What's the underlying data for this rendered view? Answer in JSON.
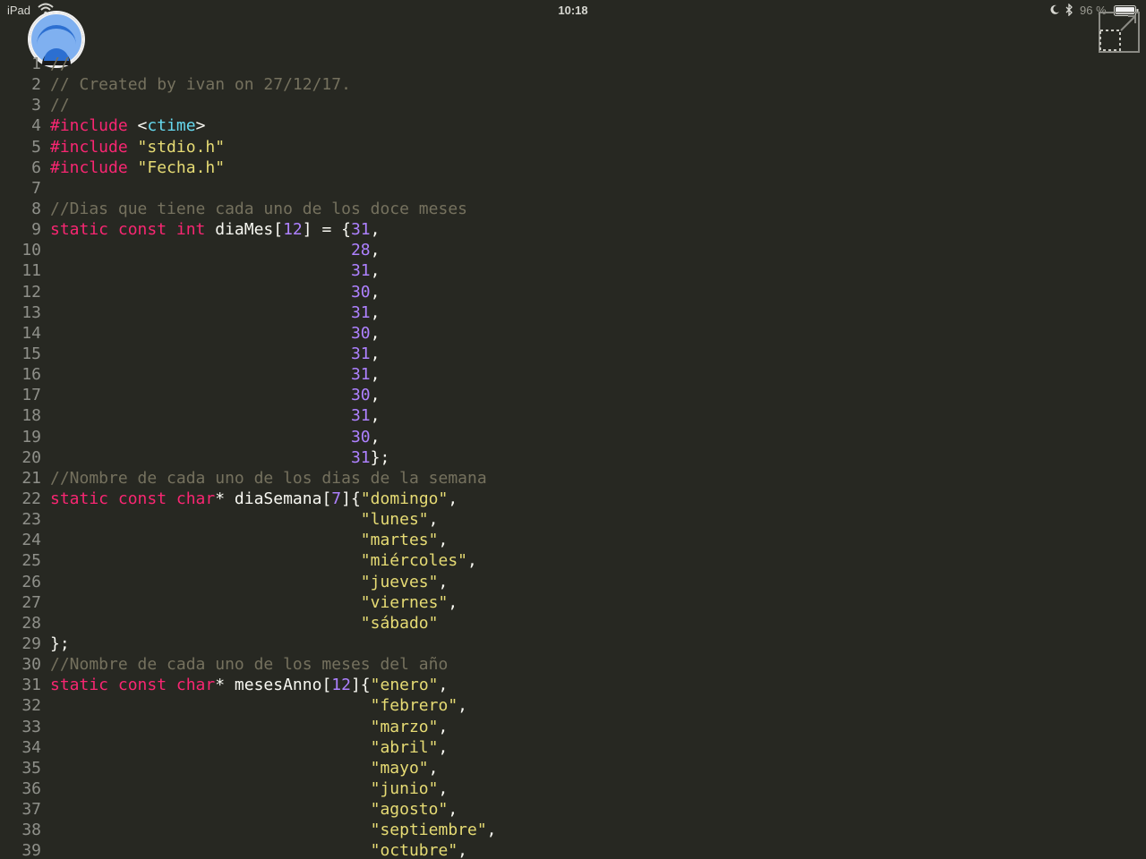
{
  "status_bar": {
    "device": "iPad",
    "time": "10:18",
    "battery": "96 %"
  },
  "colors": {
    "background": "#272822",
    "comment": "#75715e",
    "keyword": "#f92672",
    "string": "#e6db74",
    "number": "#ae81ff",
    "header": "#66d9ef",
    "plain": "#f8f8f2",
    "line_number": "#8f908a"
  },
  "icons": [
    "wifi-icon",
    "moon-icon",
    "bluetooth-icon",
    "battery-icon",
    "app-menu-icon",
    "expand-icon"
  ],
  "editor": {
    "lines": [
      {
        "n": "1",
        "tokens": [
          {
            "t": "comment",
            "v": "//"
          }
        ]
      },
      {
        "n": "2",
        "tokens": [
          {
            "t": "comment",
            "v": "// Created by ivan on 27/12/17."
          }
        ]
      },
      {
        "n": "3",
        "tokens": [
          {
            "t": "comment",
            "v": "//"
          }
        ]
      },
      {
        "n": "4",
        "tokens": [
          {
            "t": "keyword",
            "v": "#include"
          },
          {
            "t": "plain",
            "v": " <"
          },
          {
            "t": "header",
            "v": "ctime"
          },
          {
            "t": "plain",
            "v": ">"
          }
        ]
      },
      {
        "n": "5",
        "tokens": [
          {
            "t": "keyword",
            "v": "#include"
          },
          {
            "t": "plain",
            "v": " "
          },
          {
            "t": "string",
            "v": "\"stdio.h\""
          }
        ]
      },
      {
        "n": "6",
        "tokens": [
          {
            "t": "keyword",
            "v": "#include"
          },
          {
            "t": "plain",
            "v": " "
          },
          {
            "t": "string",
            "v": "\"Fecha.h\""
          }
        ]
      },
      {
        "n": "7",
        "tokens": []
      },
      {
        "n": "8",
        "tokens": [
          {
            "t": "comment",
            "v": "//Dias que tiene cada uno de los doce meses"
          }
        ]
      },
      {
        "n": "9",
        "tokens": [
          {
            "t": "keyword",
            "v": "static const int"
          },
          {
            "t": "plain",
            "v": " diaMes["
          },
          {
            "t": "number",
            "v": "12"
          },
          {
            "t": "plain",
            "v": "] = {"
          },
          {
            "t": "number",
            "v": "31"
          },
          {
            "t": "plain",
            "v": ","
          }
        ]
      },
      {
        "n": "10",
        "tokens": [
          {
            "t": "plain",
            "v": "                               "
          },
          {
            "t": "number",
            "v": "28"
          },
          {
            "t": "plain",
            "v": ","
          }
        ]
      },
      {
        "n": "11",
        "tokens": [
          {
            "t": "plain",
            "v": "                               "
          },
          {
            "t": "number",
            "v": "31"
          },
          {
            "t": "plain",
            "v": ","
          }
        ]
      },
      {
        "n": "12",
        "tokens": [
          {
            "t": "plain",
            "v": "                               "
          },
          {
            "t": "number",
            "v": "30"
          },
          {
            "t": "plain",
            "v": ","
          }
        ]
      },
      {
        "n": "13",
        "tokens": [
          {
            "t": "plain",
            "v": "                               "
          },
          {
            "t": "number",
            "v": "31"
          },
          {
            "t": "plain",
            "v": ","
          }
        ]
      },
      {
        "n": "14",
        "tokens": [
          {
            "t": "plain",
            "v": "                               "
          },
          {
            "t": "number",
            "v": "30"
          },
          {
            "t": "plain",
            "v": ","
          }
        ]
      },
      {
        "n": "15",
        "tokens": [
          {
            "t": "plain",
            "v": "                               "
          },
          {
            "t": "number",
            "v": "31"
          },
          {
            "t": "plain",
            "v": ","
          }
        ]
      },
      {
        "n": "16",
        "tokens": [
          {
            "t": "plain",
            "v": "                               "
          },
          {
            "t": "number",
            "v": "31"
          },
          {
            "t": "plain",
            "v": ","
          }
        ]
      },
      {
        "n": "17",
        "tokens": [
          {
            "t": "plain",
            "v": "                               "
          },
          {
            "t": "number",
            "v": "30"
          },
          {
            "t": "plain",
            "v": ","
          }
        ]
      },
      {
        "n": "18",
        "tokens": [
          {
            "t": "plain",
            "v": "                               "
          },
          {
            "t": "number",
            "v": "31"
          },
          {
            "t": "plain",
            "v": ","
          }
        ]
      },
      {
        "n": "19",
        "tokens": [
          {
            "t": "plain",
            "v": "                               "
          },
          {
            "t": "number",
            "v": "30"
          },
          {
            "t": "plain",
            "v": ","
          }
        ]
      },
      {
        "n": "20",
        "tokens": [
          {
            "t": "plain",
            "v": "                               "
          },
          {
            "t": "number",
            "v": "31"
          },
          {
            "t": "plain",
            "v": "};"
          }
        ]
      },
      {
        "n": "21",
        "tokens": [
          {
            "t": "comment",
            "v": "//Nombre de cada uno de los dias de la semana"
          }
        ]
      },
      {
        "n": "22",
        "tokens": [
          {
            "t": "keyword",
            "v": "static const char"
          },
          {
            "t": "plain",
            "v": "* diaSemana["
          },
          {
            "t": "number",
            "v": "7"
          },
          {
            "t": "plain",
            "v": "]{"
          },
          {
            "t": "string",
            "v": "\"domingo\""
          },
          {
            "t": "plain",
            "v": ","
          }
        ]
      },
      {
        "n": "23",
        "tokens": [
          {
            "t": "plain",
            "v": "                                "
          },
          {
            "t": "string",
            "v": "\"lunes\""
          },
          {
            "t": "plain",
            "v": ","
          }
        ]
      },
      {
        "n": "24",
        "tokens": [
          {
            "t": "plain",
            "v": "                                "
          },
          {
            "t": "string",
            "v": "\"martes\""
          },
          {
            "t": "plain",
            "v": ","
          }
        ]
      },
      {
        "n": "25",
        "tokens": [
          {
            "t": "plain",
            "v": "                                "
          },
          {
            "t": "string",
            "v": "\"miércoles\""
          },
          {
            "t": "plain",
            "v": ","
          }
        ]
      },
      {
        "n": "26",
        "tokens": [
          {
            "t": "plain",
            "v": "                                "
          },
          {
            "t": "string",
            "v": "\"jueves\""
          },
          {
            "t": "plain",
            "v": ","
          }
        ]
      },
      {
        "n": "27",
        "tokens": [
          {
            "t": "plain",
            "v": "                                "
          },
          {
            "t": "string",
            "v": "\"viernes\""
          },
          {
            "t": "plain",
            "v": ","
          }
        ]
      },
      {
        "n": "28",
        "tokens": [
          {
            "t": "plain",
            "v": "                                "
          },
          {
            "t": "string",
            "v": "\"sábado\""
          }
        ]
      },
      {
        "n": "29",
        "tokens": [
          {
            "t": "plain",
            "v": "};"
          }
        ]
      },
      {
        "n": "30",
        "tokens": [
          {
            "t": "comment",
            "v": "//Nombre de cada uno de los meses del año"
          }
        ]
      },
      {
        "n": "31",
        "tokens": [
          {
            "t": "keyword",
            "v": "static const char"
          },
          {
            "t": "plain",
            "v": "* mesesAnno["
          },
          {
            "t": "number",
            "v": "12"
          },
          {
            "t": "plain",
            "v": "]{"
          },
          {
            "t": "string",
            "v": "\"enero\""
          },
          {
            "t": "plain",
            "v": ","
          }
        ]
      },
      {
        "n": "32",
        "tokens": [
          {
            "t": "plain",
            "v": "                                 "
          },
          {
            "t": "string",
            "v": "\"febrero\""
          },
          {
            "t": "plain",
            "v": ","
          }
        ]
      },
      {
        "n": "33",
        "tokens": [
          {
            "t": "plain",
            "v": "                                 "
          },
          {
            "t": "string",
            "v": "\"marzo\""
          },
          {
            "t": "plain",
            "v": ","
          }
        ]
      },
      {
        "n": "34",
        "tokens": [
          {
            "t": "plain",
            "v": "                                 "
          },
          {
            "t": "string",
            "v": "\"abril\""
          },
          {
            "t": "plain",
            "v": ","
          }
        ]
      },
      {
        "n": "35",
        "tokens": [
          {
            "t": "plain",
            "v": "                                 "
          },
          {
            "t": "string",
            "v": "\"mayo\""
          },
          {
            "t": "plain",
            "v": ","
          }
        ]
      },
      {
        "n": "36",
        "tokens": [
          {
            "t": "plain",
            "v": "                                 "
          },
          {
            "t": "string",
            "v": "\"junio\""
          },
          {
            "t": "plain",
            "v": ","
          }
        ]
      },
      {
        "n": "37",
        "tokens": [
          {
            "t": "plain",
            "v": "                                 "
          },
          {
            "t": "string",
            "v": "\"agosto\""
          },
          {
            "t": "plain",
            "v": ","
          }
        ]
      },
      {
        "n": "38",
        "tokens": [
          {
            "t": "plain",
            "v": "                                 "
          },
          {
            "t": "string",
            "v": "\"septiembre\""
          },
          {
            "t": "plain",
            "v": ","
          }
        ]
      },
      {
        "n": "39",
        "tokens": [
          {
            "t": "plain",
            "v": "                                 "
          },
          {
            "t": "string",
            "v": "\"octubre\""
          },
          {
            "t": "plain",
            "v": ","
          }
        ]
      }
    ]
  }
}
